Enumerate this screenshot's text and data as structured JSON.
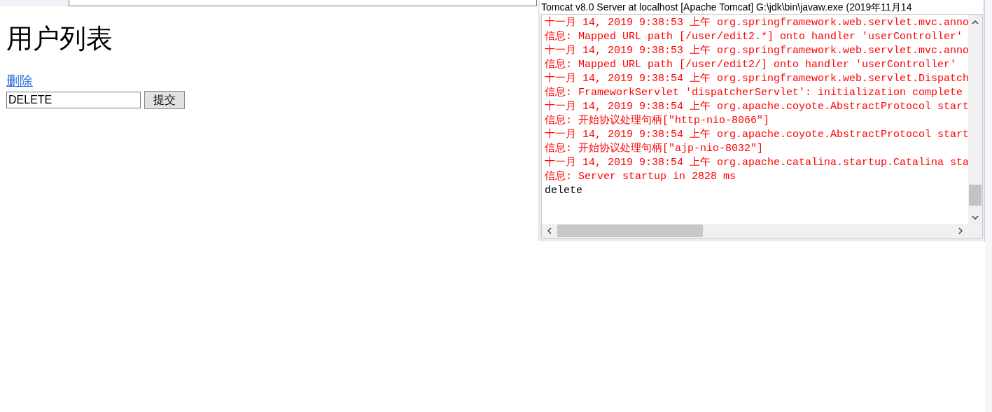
{
  "page": {
    "heading": "用户列表",
    "link": "删除",
    "input": {
      "value": "DELETE"
    },
    "submit": "提交"
  },
  "console": {
    "title": "Tomcat v8.0 Server at localhost [Apache Tomcat] G:\\jdk\\bin\\javaw.exe (2019年11月14",
    "lines": [
      {
        "kind": "stderr",
        "text": "十一月 14, 2019 9:38:53 上午 org.springframework.web.servlet.mvc.anno"
      },
      {
        "kind": "stderr",
        "text": "信息: Mapped URL path [/user/edit2.*] onto handler 'userController'"
      },
      {
        "kind": "stderr",
        "text": "十一月 14, 2019 9:38:53 上午 org.springframework.web.servlet.mvc.anno"
      },
      {
        "kind": "stderr",
        "text": "信息: Mapped URL path [/user/edit2/] onto handler 'userController'"
      },
      {
        "kind": "stderr",
        "text": "十一月 14, 2019 9:38:54 上午 org.springframework.web.servlet.Dispatch"
      },
      {
        "kind": "stderr",
        "text": "信息: FrameworkServlet 'dispatcherServlet': initialization complete"
      },
      {
        "kind": "stderr",
        "text": "十一月 14, 2019 9:38:54 上午 org.apache.coyote.AbstractProtocol start"
      },
      {
        "kind": "stderr",
        "text": "信息: 开始协议处理句柄[\"http-nio-8066\"]"
      },
      {
        "kind": "stderr",
        "text": "十一月 14, 2019 9:38:54 上午 org.apache.coyote.AbstractProtocol start"
      },
      {
        "kind": "stderr",
        "text": "信息: 开始协议处理句柄[\"ajp-nio-8032\"]"
      },
      {
        "kind": "stderr",
        "text": "十一月 14, 2019 9:38:54 上午 org.apache.catalina.startup.Catalina sta"
      },
      {
        "kind": "stderr",
        "text": "信息: Server startup in 2828 ms"
      },
      {
        "kind": "stdout",
        "text": "delete"
      }
    ]
  }
}
